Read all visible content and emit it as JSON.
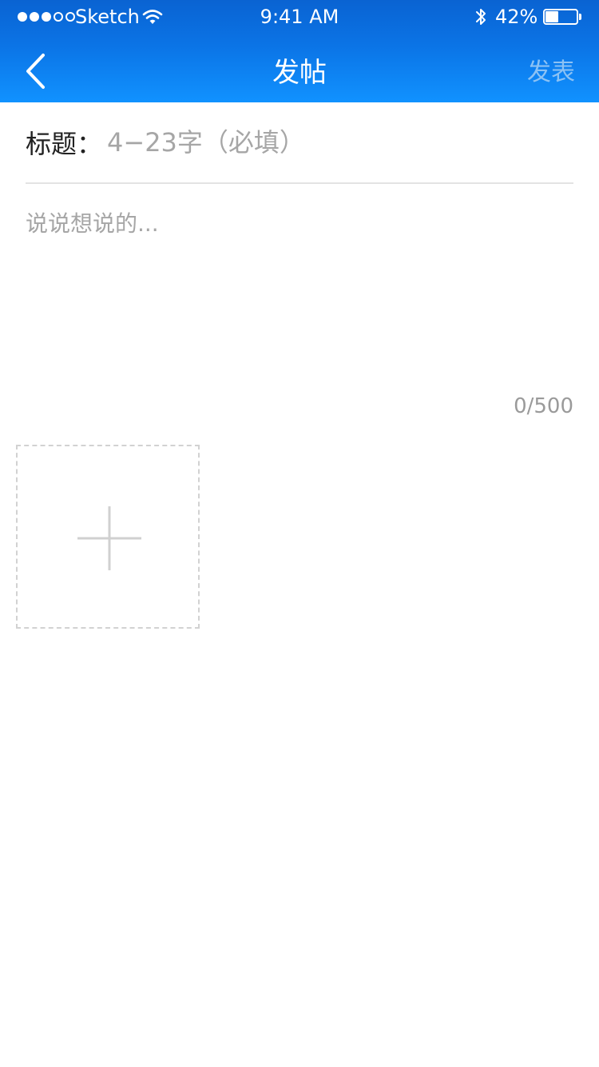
{
  "status_bar": {
    "carrier": "Sketch",
    "time": "9:41 AM",
    "battery_percent": "42%",
    "battery_level": 0.42,
    "signal_bars_filled": 3,
    "signal_bars_total": 5
  },
  "nav": {
    "title": "发帖",
    "publish_label": "发表",
    "back_icon": "chevron-left-icon"
  },
  "form": {
    "title_label": "标题：",
    "title_value": "",
    "title_placeholder": "4−23字（必填）",
    "body_value": "",
    "body_placeholder": "说说想说的...",
    "char_count": "0/500",
    "add_image_icon": "plus-icon"
  },
  "colors": {
    "header_top": "#0a63d2",
    "header_bottom": "#1192ff",
    "publish_disabled": "#8cc2f4",
    "placeholder": "#a6a6a6"
  }
}
